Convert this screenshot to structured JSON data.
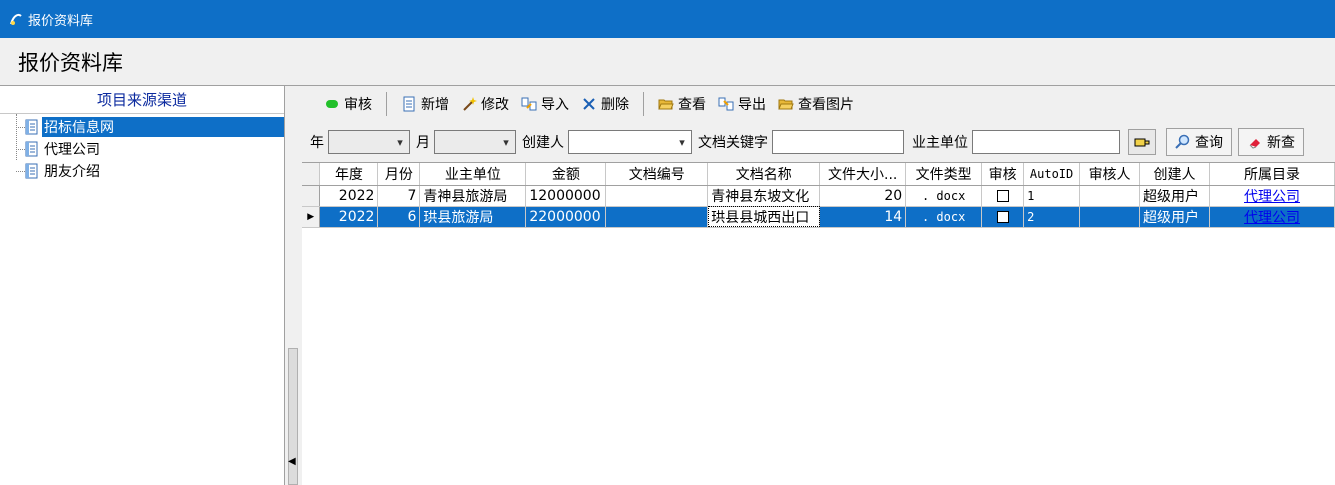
{
  "window": {
    "title": "报价资料库"
  },
  "page": {
    "heading": "报价资料库"
  },
  "sidebar": {
    "header": "项目来源渠道",
    "items": [
      {
        "label": "招标信息网",
        "selected": true
      },
      {
        "label": "代理公司",
        "selected": false
      },
      {
        "label": "朋友介绍",
        "selected": false
      }
    ]
  },
  "toolbar": {
    "approve": "审核",
    "add": "新增",
    "edit": "修改",
    "import": "导入",
    "delete": "删除",
    "view": "查看",
    "export": "导出",
    "view_image": "查看图片"
  },
  "filters": {
    "year_label": "年",
    "year_value": "",
    "month_label": "月",
    "month_value": "",
    "creator_label": "创建人",
    "creator_value": "",
    "keyword_label": "文档关键字",
    "keyword_value": "",
    "owner_label": "业主单位",
    "owner_value": "",
    "query_button": "查询",
    "new_query_button": "新查"
  },
  "table": {
    "columns": [
      "年度",
      "月份",
      "业主单位",
      "金额",
      "文档编号",
      "文档名称",
      "文件大小...",
      "文件类型",
      "审核",
      "AutoID",
      "审核人",
      "创建人",
      "所属目录"
    ],
    "rows": [
      {
        "year": "2022",
        "month": "7",
        "owner": "青神县旅游局",
        "amount": "12000000",
        "doc_no": "",
        "doc_name": "青神县东坡文化",
        "size": "20",
        "type": ". docx",
        "approved": false,
        "auto_id": "1",
        "approver": "",
        "creator": "超级用户",
        "dir": "代理公司",
        "selected": false
      },
      {
        "year": "2022",
        "month": "6",
        "owner": "珙县旅游局",
        "amount": "22000000",
        "doc_no": "",
        "doc_name": "珙县县城西出口",
        "size": "14",
        "type": ". docx",
        "approved": false,
        "auto_id": "2",
        "approver": "",
        "creator": "超级用户",
        "dir": "代理公司",
        "selected": true
      }
    ]
  },
  "colors": {
    "accent": "#0e6fc7",
    "header_text": "#0b2a9f"
  }
}
